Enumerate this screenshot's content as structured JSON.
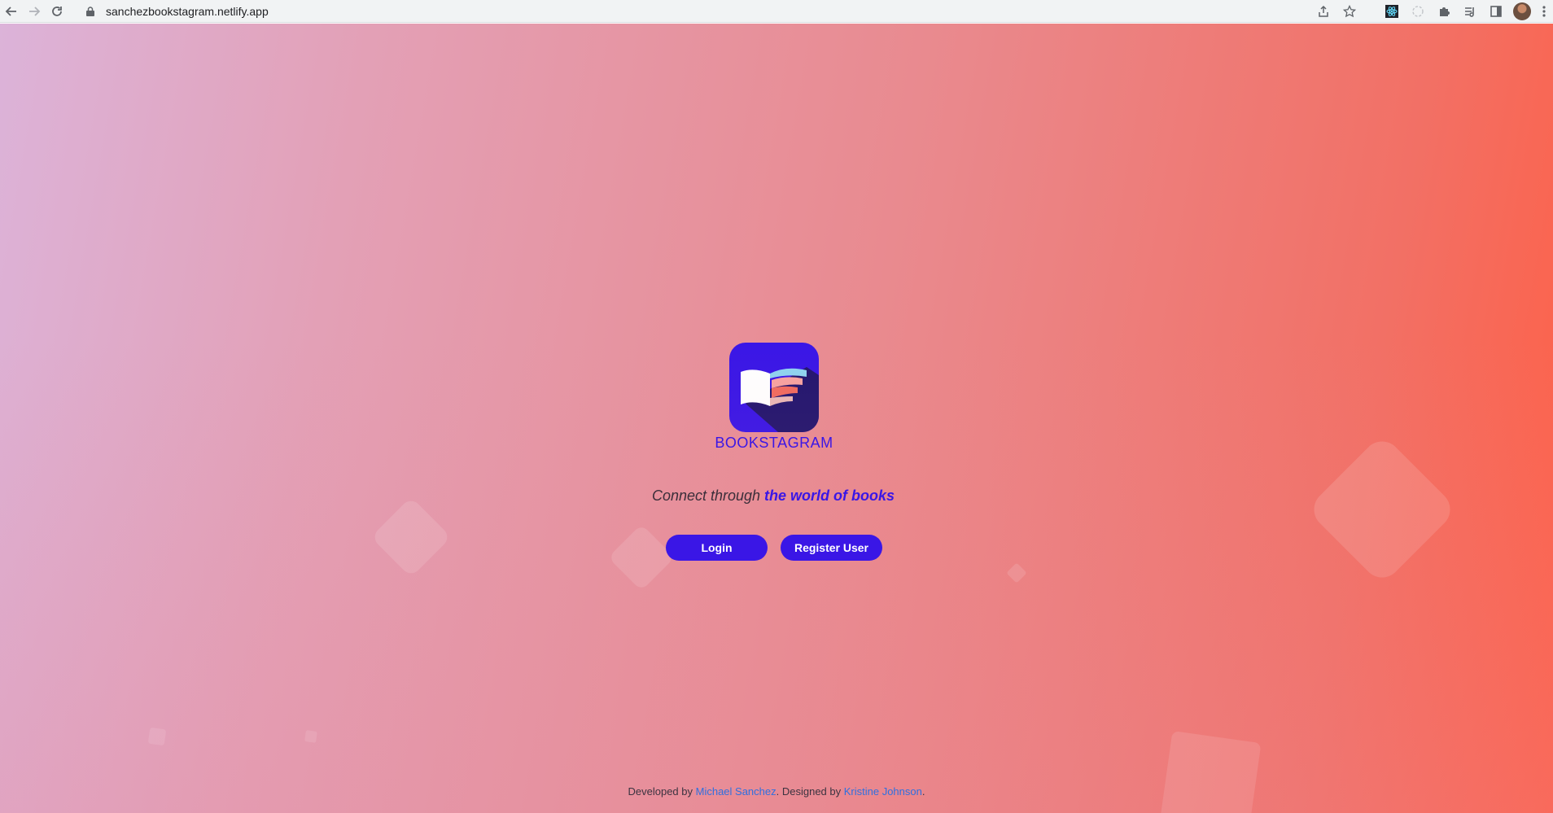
{
  "browser": {
    "url": "sanchezbookstagram.netlify.app"
  },
  "app": {
    "brand": "BOOKSTAGRAM",
    "tagline_prefix": "Connect through ",
    "tagline_highlight": "the world of books",
    "login_label": "Login",
    "register_label": "Register User"
  },
  "footer": {
    "dev_prefix": "Developed by ",
    "developer": "Michael Sanchez",
    "design_prefix": ". Designed by ",
    "designer": "Kristine Johnson",
    "suffix": "."
  },
  "colors": {
    "accent": "#3a16e6",
    "link": "#2f6fe0"
  },
  "icons": [
    "back-arrow-icon",
    "forward-arrow-icon",
    "reload-icon",
    "lock-icon",
    "share-icon",
    "star-icon",
    "react-devtools-icon",
    "extension-icon",
    "puzzle-icon",
    "reading-list-icon",
    "side-panel-icon",
    "avatar",
    "menu-dots-icon",
    "book-logo-icon"
  ]
}
